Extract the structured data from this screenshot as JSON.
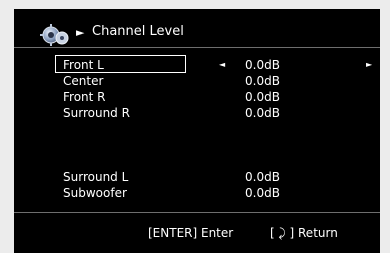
{
  "header": {
    "icon": "gear-icon",
    "arrow": "►",
    "title": "Channel Level"
  },
  "channels": [
    {
      "label": "Front L",
      "value": "0.0dB",
      "selected": true
    },
    {
      "label": "Center",
      "value": "0.0dB",
      "selected": false
    },
    {
      "label": "Front R",
      "value": "0.0dB",
      "selected": false
    },
    {
      "label": "Surround R",
      "value": "0.0dB",
      "selected": false
    },
    {
      "label": "Surround L",
      "value": "0.0dB",
      "selected": false
    },
    {
      "label": "Subwoofer",
      "value": "0.0dB",
      "selected": false
    }
  ],
  "selector": {
    "left_arrow": "◄",
    "right_arrow": "►"
  },
  "footer": {
    "enter_hint": "[ENTER] Enter",
    "return_hint": "[ ⤸ ] Return"
  },
  "colors": {
    "background": "#000000",
    "text": "#ffffff",
    "divider": "#6e6e6e",
    "frame": "#ececec"
  }
}
